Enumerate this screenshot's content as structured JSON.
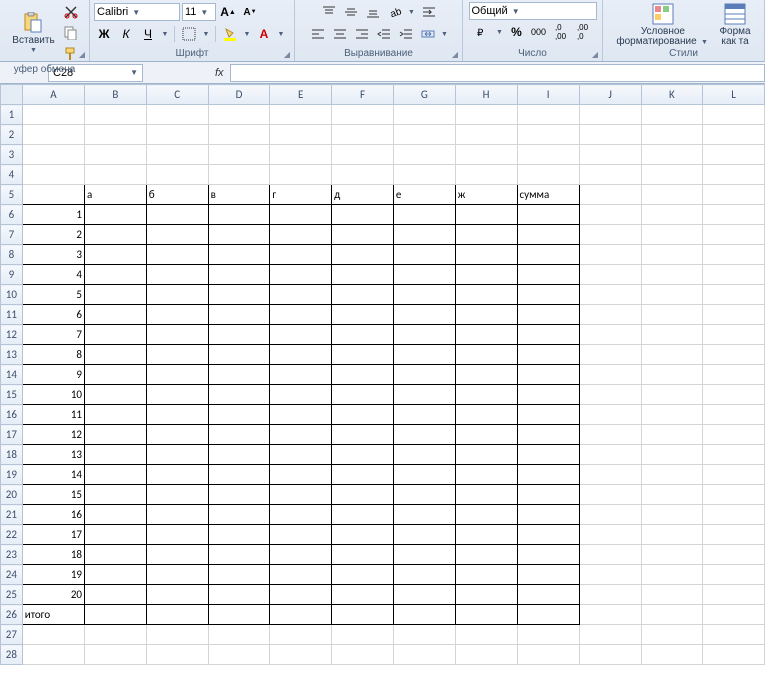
{
  "ribbon": {
    "clipboard": {
      "title": "уфер обмена",
      "paste": "Вставить"
    },
    "font": {
      "title": "Шрифт",
      "name": "Calibri",
      "size": "11",
      "bold": "Ж",
      "italic": "К",
      "underline": "Ч"
    },
    "alignment": {
      "title": "Выравнивание"
    },
    "number": {
      "title": "Число",
      "format": "Общий"
    },
    "styles": {
      "title": "Стили",
      "cond": "Условное",
      "cond2": "форматирование",
      "format": "Форма",
      "format2": "как та"
    }
  },
  "namebox": "C28",
  "fx_label": "fx",
  "columns": [
    "A",
    "B",
    "C",
    "D",
    "E",
    "F",
    "G",
    "H",
    "I",
    "J",
    "K",
    "L"
  ],
  "row_count": 28,
  "cells": {
    "r5": {
      "B": "а",
      "C": "б",
      "D": "в",
      "E": "г",
      "F": "д",
      "G": "е",
      "H": "ж",
      "I": "сумма"
    },
    "r6": {
      "A": "1"
    },
    "r7": {
      "A": "2"
    },
    "r8": {
      "A": "3"
    },
    "r9": {
      "A": "4"
    },
    "r10": {
      "A": "5"
    },
    "r11": {
      "A": "6"
    },
    "r12": {
      "A": "7"
    },
    "r13": {
      "A": "8"
    },
    "r14": {
      "A": "9"
    },
    "r15": {
      "A": "10"
    },
    "r16": {
      "A": "11"
    },
    "r17": {
      "A": "12"
    },
    "r18": {
      "A": "13"
    },
    "r19": {
      "A": "14"
    },
    "r20": {
      "A": "15"
    },
    "r21": {
      "A": "16"
    },
    "r22": {
      "A": "17"
    },
    "r23": {
      "A": "18"
    },
    "r24": {
      "A": "19"
    },
    "r25": {
      "A": "20"
    },
    "r26": {
      "A": "итого"
    }
  },
  "border_region": {
    "rowStart": 5,
    "rowEnd": 26,
    "colStart": "A",
    "colEnd": "I"
  }
}
